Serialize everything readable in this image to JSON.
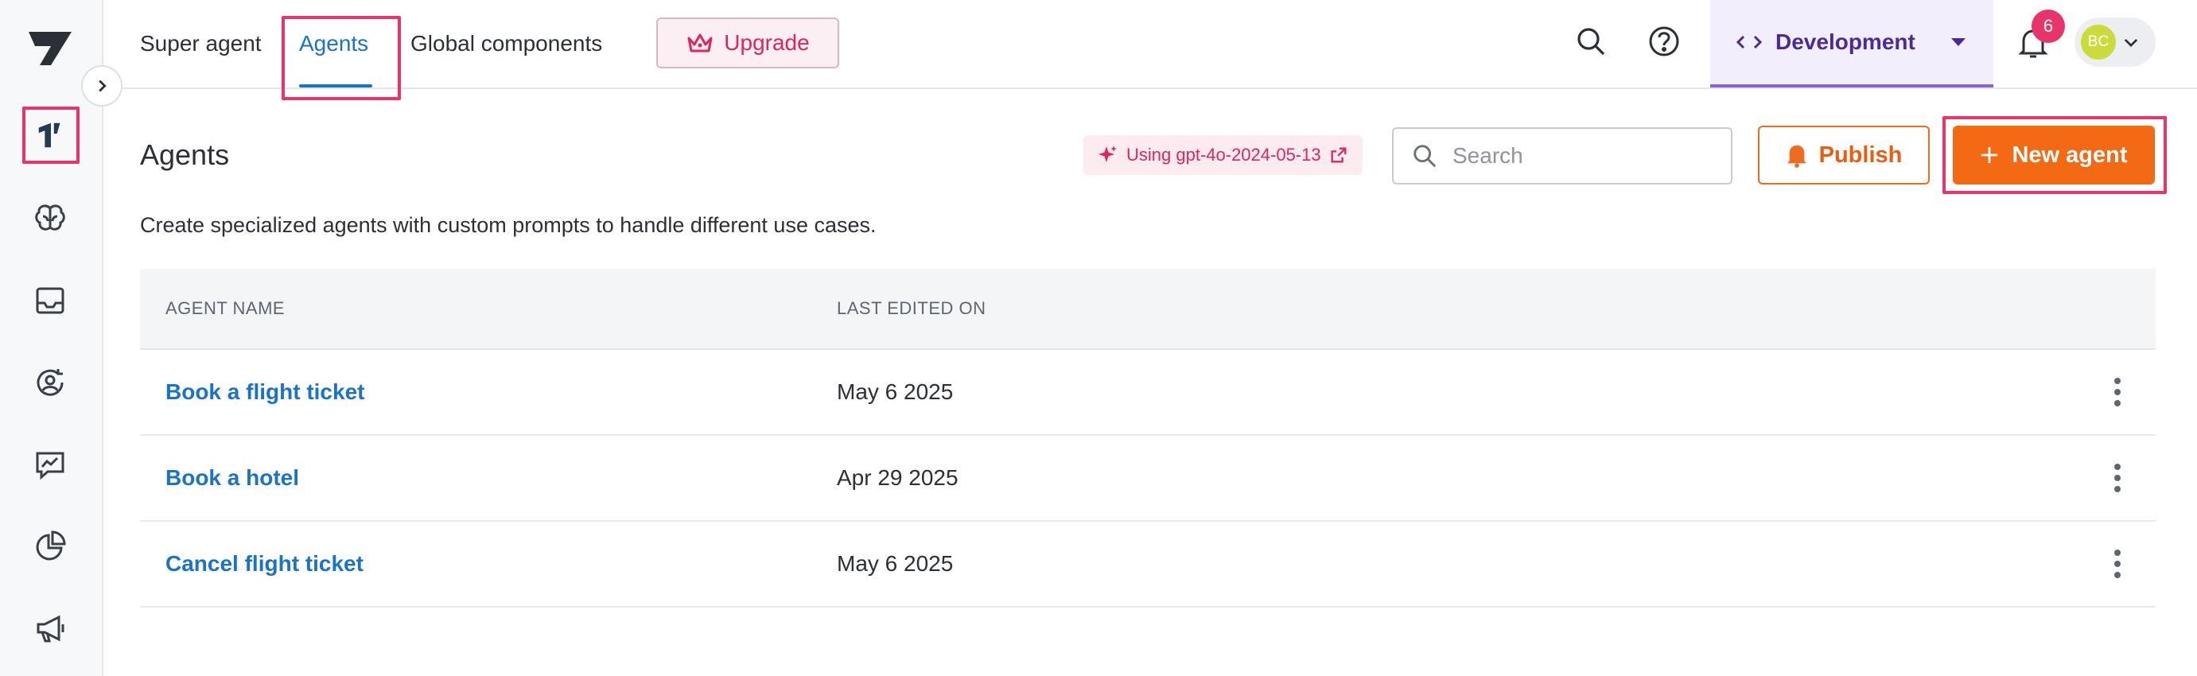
{
  "colors": {
    "accent_blue": "#1a73c8",
    "brand_orange": "#f46a14",
    "highlight_pink": "#e8336b",
    "env_purple": "#4d2a99"
  },
  "rail": {
    "icons": [
      "logo-icon",
      "app-icon",
      "brain-icon",
      "inbox-icon",
      "user-sync-icon",
      "chart-chat-icon",
      "pie-chart-icon",
      "megaphone-icon"
    ]
  },
  "nav": {
    "tabs": [
      {
        "label": "Super agent"
      },
      {
        "label": "Agents",
        "active": true
      },
      {
        "label": "Global components"
      }
    ],
    "upgrade_label": "Upgrade",
    "environment": "Development",
    "notifications_count": "6",
    "avatar_initials": "BC"
  },
  "main": {
    "title": "Agents",
    "model_label": "Using gpt-4o-2024-05-13",
    "search_placeholder": "Search",
    "publish_label": "Publish",
    "new_agent_label": "New agent",
    "subtitle": "Create specialized agents with custom prompts to handle different use cases."
  },
  "table": {
    "columns": [
      "AGENT NAME",
      "LAST EDITED ON"
    ],
    "rows": [
      {
        "name": "Book a flight ticket",
        "edited": "May 6 2025"
      },
      {
        "name": "Book a hotel",
        "edited": "Apr 29 2025"
      },
      {
        "name": "Cancel flight ticket",
        "edited": "May 6 2025"
      }
    ]
  }
}
